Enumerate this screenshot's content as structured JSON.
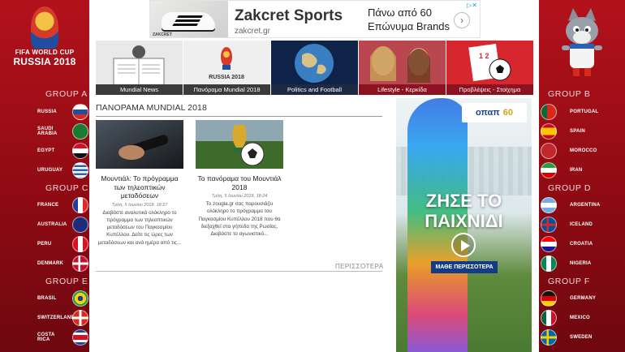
{
  "left_skin": {
    "logo_line1": "FIFA WORLD CUP",
    "logo_line2": "RUSSIA 2018",
    "groups": [
      {
        "title": "GROUP A",
        "teams": [
          "RUSSIA",
          "SAUDI ARABIA",
          "EGYPT",
          "URUGUAY"
        ]
      },
      {
        "title": "GROUP C",
        "teams": [
          "FRANCE",
          "AUSTRALIA",
          "PERU",
          "DENMARK"
        ]
      },
      {
        "title": "GROUP E",
        "teams": [
          "BRASIL",
          "SWITZERLAND",
          "COSTA RICA"
        ]
      }
    ]
  },
  "right_skin": {
    "groups": [
      {
        "title": "GROUP B",
        "teams": [
          "PORTUGAL",
          "SPAIN",
          "MOROCCO",
          "IRAN"
        ]
      },
      {
        "title": "GROUP D",
        "teams": [
          "ARGENTINA",
          "ICELAND",
          "CROATIA",
          "NIGERIA"
        ]
      },
      {
        "title": "GROUP F",
        "teams": [
          "GERMANY",
          "MEXICO",
          "SWEDEN"
        ]
      }
    ]
  },
  "top_ad": {
    "image_brand": "ZAKCRET",
    "title": "Zakcret Sports",
    "url": "zakcret.gr",
    "line1": "Πάνω από 60",
    "line2": "Επώνυμα Brands",
    "arrow": "›"
  },
  "tiles": [
    {
      "label": "Mundial News"
    },
    {
      "label": "Πανόραμα Mundial 2018",
      "img_text": "RUSSIA 2018"
    },
    {
      "label": "Politics and Football"
    },
    {
      "label": "Lifestyle - Κερκίδα"
    },
    {
      "label": "Προβλέψεις - Στοίχημα"
    }
  ],
  "section": {
    "title": "ΠΑΝΟΡΑΜΑ MUNDIAL 2018",
    "more": "ΠΕΡΙΣΣΟΤΕΡΑ"
  },
  "articles": [
    {
      "title": "Μουντιάλ: Το πρόγραμμα των τηλεοπτικών μεταδόσεων",
      "date": "Τρίτη, 5 Ιουνίου 2018, 18:27",
      "excerpt": "Διαβάστε αναλυτικά ολόκληρο το πρόγραμμα των τηλεοπτικών μεταδόσεων του Παγκοσμίου Κυπέλλου. Δείτε τις ώρες των μεταδόσεων και ανά ημέρα από τις..."
    },
    {
      "title": "Το πανόραμα του Μουντιάλ 2018",
      "date": "Τρίτη, 5 Ιουνίου 2018, 18:24",
      "excerpt": "Το zougla.gr σας παρουσιάζει ολόκληρο το πρόγραμμα του Παγκοσμίου Κυπέλλου 2018 που θα διεξαχθεί στα γήπεδα της Ρωσίας. Διαβάστε το αγωνιστικό..."
    }
  ],
  "side_ad": {
    "brand": "οπαπ",
    "anniversary": "60",
    "headline_line1": "ΖΗΣΕ ΤΟ",
    "headline_line2": "ΠΑΙΧΝΙΔΙ",
    "cta": "ΜΑΘΕ ΠΕΡΙΣΣΟΤΕΡΑ"
  }
}
